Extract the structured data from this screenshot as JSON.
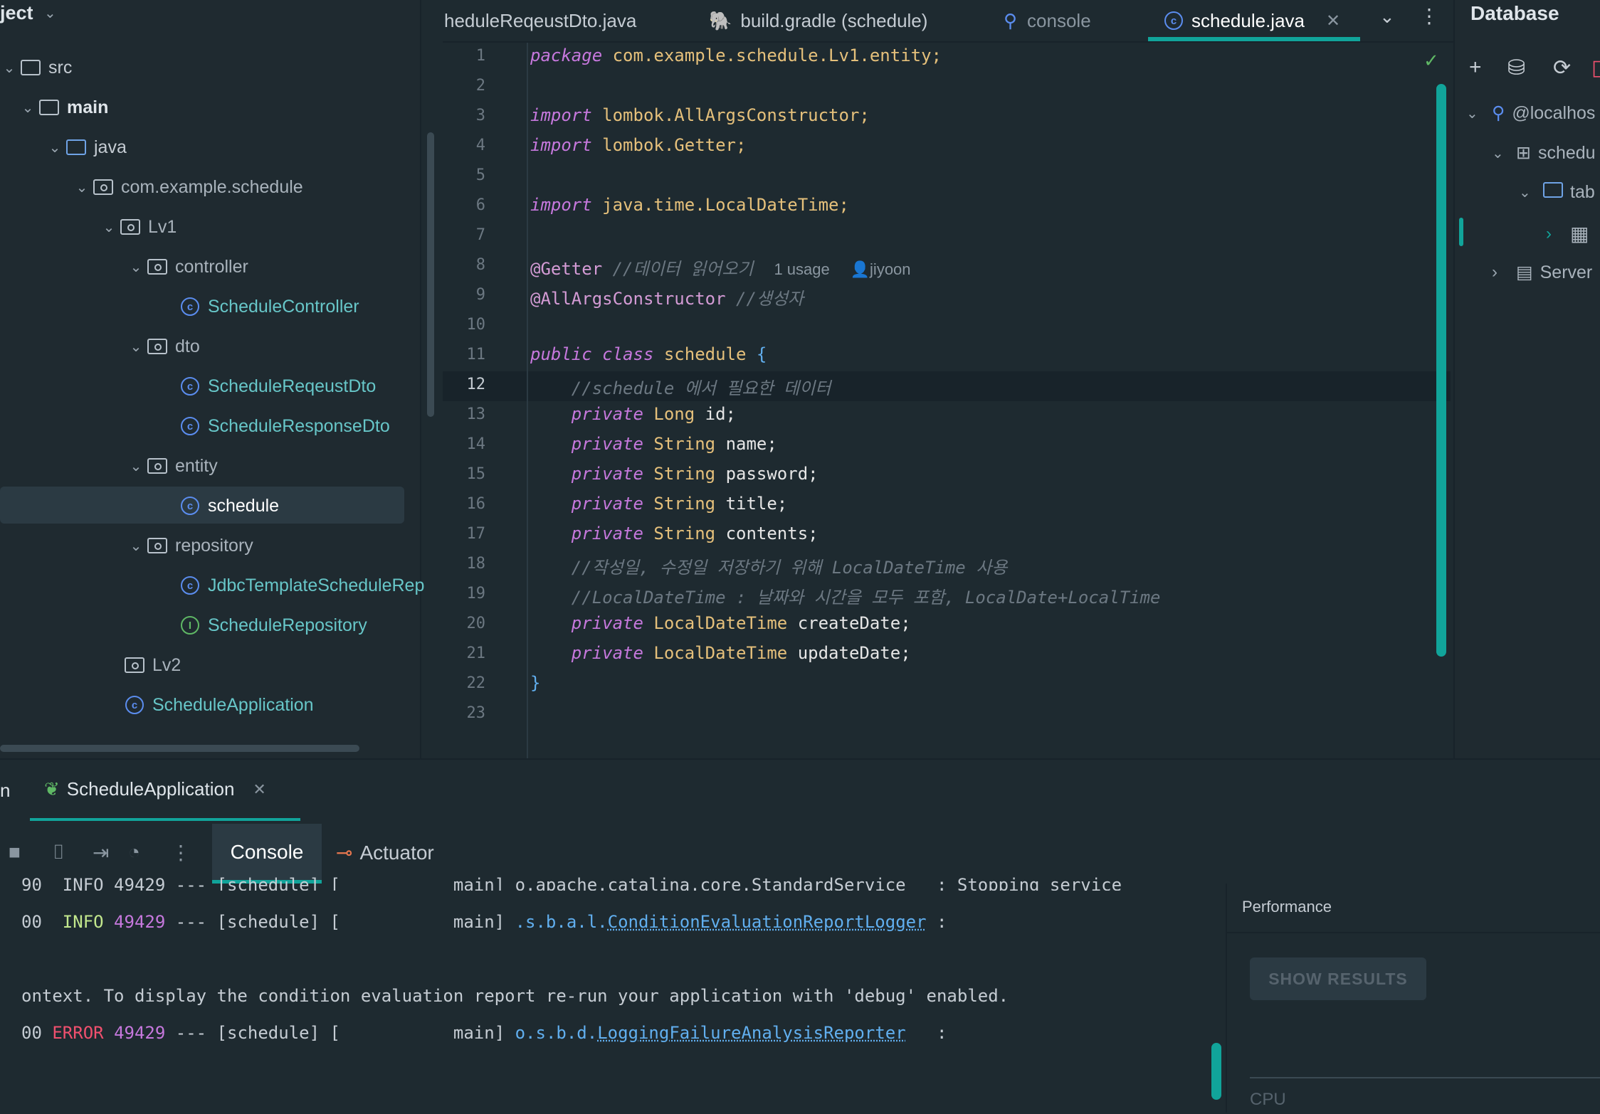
{
  "project": {
    "title": "ject",
    "tree": [
      {
        "label": "src"
      },
      {
        "label": "main"
      },
      {
        "label": "java"
      },
      {
        "label": "com.example.schedule"
      },
      {
        "label": "Lv1"
      },
      {
        "label": "controller"
      },
      {
        "label": "ScheduleController"
      },
      {
        "label": "dto"
      },
      {
        "label": "ScheduleReqeustDto"
      },
      {
        "label": "ScheduleResponseDto"
      },
      {
        "label": "entity"
      },
      {
        "label": "schedule"
      },
      {
        "label": "repository"
      },
      {
        "label": "JdbcTemplateScheduleRep"
      },
      {
        "label": "ScheduleRepository"
      },
      {
        "label": "Lv2"
      },
      {
        "label": "ScheduleApplication"
      }
    ]
  },
  "tabs": [
    {
      "label": "heduleReqeustDto.java"
    },
    {
      "label": "build.gradle (schedule)"
    },
    {
      "label": "console"
    },
    {
      "label": "schedule.java",
      "active": true
    }
  ],
  "editor": {
    "line_numbers": [
      "1",
      "2",
      "3",
      "4",
      "5",
      "6",
      "7",
      "8",
      "9",
      "10",
      "11",
      "12",
      "13",
      "14",
      "15",
      "16",
      "17",
      "18",
      "19",
      "20",
      "21",
      "22",
      "23"
    ],
    "current_line": 12,
    "code": {
      "l1_kw": "package",
      "l1_rest": "com.example.schedule.Lv1.entity;",
      "l3_kw": "import",
      "l3_rest": "lombok.AllArgsConstructor;",
      "l4_kw": "import",
      "l4_rest": "lombok.Getter;",
      "l6_kw": "import",
      "l6_rest": "java.time.LocalDateTime;",
      "l8_an": "@Getter",
      "l8_cm": "//데이터 읽어오기",
      "l8_hint_usage": "1 usage",
      "l8_hint_author": "jiyoon",
      "l9_an": "@AllArgsConstructor",
      "l9_cm": "//생성자",
      "l11_kw1": "public",
      "l11_kw2": "class",
      "l11_name": "schedule",
      "l11_brace": "{",
      "l12_cm": "//schedule 에서 필요한 데이터",
      "l13_kw": "private",
      "l13_ty": "Long",
      "l13_rest": "id;",
      "l14_kw": "private",
      "l14_ty": "String",
      "l14_rest": "name;",
      "l15_kw": "private",
      "l15_ty": "String",
      "l15_rest": "password;",
      "l16_kw": "private",
      "l16_ty": "String",
      "l16_rest": "title;",
      "l17_kw": "private",
      "l17_ty": "String",
      "l17_rest": "contents;",
      "l18_cm": "//작성일, 수정일 저장하기 위해 LocalDateTime 사용",
      "l19_cm": "//LocalDateTime : 날짜와 시간을 모두 포함, LocalDate+LocalTime",
      "l20_kw": "private",
      "l20_ty": "LocalDateTime",
      "l20_rest": "createDate;",
      "l21_kw": "private",
      "l21_ty": "LocalDateTime",
      "l21_rest": "updateDate;",
      "l22_brace": "}"
    }
  },
  "database": {
    "title": "Database",
    "rows": [
      "@localhos",
      "schedu",
      "tab",
      "Server"
    ]
  },
  "run": {
    "panel_label": "n",
    "tab_label": "ScheduleApplication",
    "console_label": "Console",
    "actuator_label": "Actuator",
    "logs": {
      "l1": "90  INFO 49429 --- [schedule] [           main] o.apache.catalina.core.StandardService   : Stopping service",
      "l2_pre": "00  ",
      "l2_level": "INFO",
      "l2_pid": "49429",
      "l2_mid": " --- [schedule] [           main] ",
      "l2_pkg": ".s.b.a.l.",
      "l2_cls": "ConditionEvaluationReportLogger",
      "l2_tail": " :",
      "l3": "ontext. To display the condition evaluation report re-run your application with 'debug' enabled.",
      "l4_pre": "00 ",
      "l4_level": "ERROR",
      "l4_pid": "49429",
      "l4_mid": " --- [schedule] [           main] ",
      "l4_pkg": "o.s.b.d.",
      "l4_cls": "LoggingFailureAnalysisReporter",
      "l4_tail": "   :"
    },
    "performance": {
      "title": "Performance",
      "button": "SHOW RESULTS",
      "cpu": "CPU"
    }
  },
  "colors": {
    "accent": "#11a49a",
    "background": "#1e2a30"
  }
}
